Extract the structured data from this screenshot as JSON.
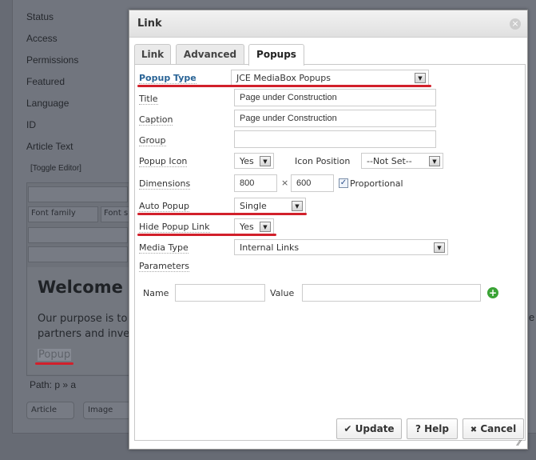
{
  "background": {
    "fields": [
      "Status",
      "Access",
      "Permissions",
      "Featured",
      "Language",
      "ID",
      "Article Text"
    ],
    "toggle_editor": "[Toggle Editor]",
    "font_family": "Font family",
    "font_size": "Font s",
    "heading": "Welcome",
    "para_line1": "Our purpose is to",
    "para_line2": "partners and inve",
    "selected_link": "Popup",
    "path": "Path:  p » a",
    "article_btn": "Article",
    "image_btn": "Image",
    "right_fragment": "e"
  },
  "dialog": {
    "title": "Link",
    "tabs": [
      {
        "label": "Link"
      },
      {
        "label": "Advanced"
      },
      {
        "label": "Popups",
        "active": true
      }
    ],
    "popup_type": {
      "label": "Popup Type",
      "value": "JCE MediaBox Popups"
    },
    "title_field": {
      "label": "Title",
      "value": "Page under Construction"
    },
    "caption": {
      "label": "Caption",
      "value": "Page under Construction"
    },
    "group": {
      "label": "Group",
      "value": ""
    },
    "popup_icon": {
      "label": "Popup Icon",
      "value": "Yes"
    },
    "icon_position": {
      "label": "Icon Position",
      "value": "--Not Set--"
    },
    "dimensions": {
      "label": "Dimensions",
      "width": "800",
      "sep": "×",
      "height": "600",
      "proportional_label": "Proportional",
      "proportional": true
    },
    "auto_popup": {
      "label": "Auto Popup",
      "value": "Single"
    },
    "hide_popup_link": {
      "label": "Hide Popup Link",
      "value": "Yes"
    },
    "media_type": {
      "label": "Media Type",
      "value": "Internal Links"
    },
    "parameters": {
      "label": "Parameters",
      "name_label": "Name",
      "value_label": "Value",
      "name": "",
      "value": ""
    },
    "buttons": {
      "update": "Update",
      "help": "Help",
      "cancel": "Cancel"
    },
    "icons": {
      "update": "✔",
      "help": "?",
      "cancel": "✖",
      "close": "×",
      "add": "+"
    }
  },
  "colors": {
    "annotation": "#d2202b",
    "label_accent": "#2a6496",
    "add": "#3aa335"
  }
}
